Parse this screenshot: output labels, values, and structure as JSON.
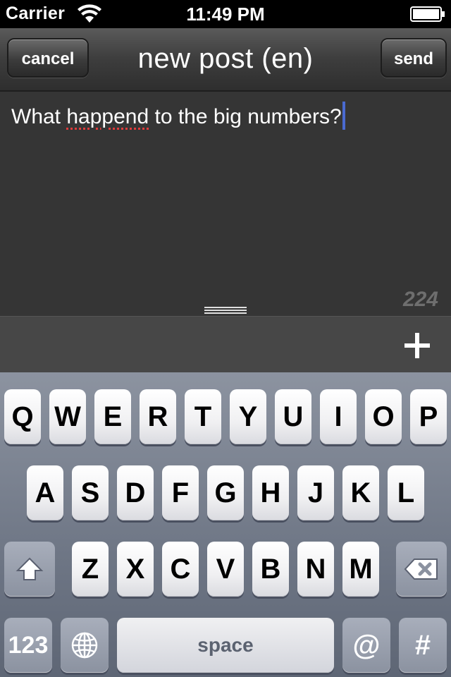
{
  "status_bar": {
    "carrier": "Carrier",
    "time": "11:49 PM",
    "wifi_icon": "wifi-icon",
    "battery_icon": "battery-icon"
  },
  "nav_bar": {
    "title": "new post (en)",
    "cancel_label": "cancel",
    "send_label": "send"
  },
  "editor": {
    "text_before": "What ",
    "text_misspelled": "happend",
    "text_after": " to the big numbers?",
    "char_count": "224",
    "grip_icon": "drag-handle-icon"
  },
  "attach_bar": {
    "add_icon": "plus-icon"
  },
  "keyboard": {
    "row1": [
      "Q",
      "W",
      "E",
      "R",
      "T",
      "Y",
      "U",
      "I",
      "O",
      "P"
    ],
    "row2": [
      "A",
      "S",
      "D",
      "F",
      "G",
      "H",
      "J",
      "K",
      "L"
    ],
    "row3": [
      "Z",
      "X",
      "C",
      "V",
      "B",
      "N",
      "M"
    ],
    "shift_icon": "shift-arrow-icon",
    "delete_icon": "backspace-icon",
    "numbers_label": "123",
    "globe_icon": "globe-icon",
    "space_label": "space",
    "at_label": "@",
    "hash_label": "#"
  }
}
